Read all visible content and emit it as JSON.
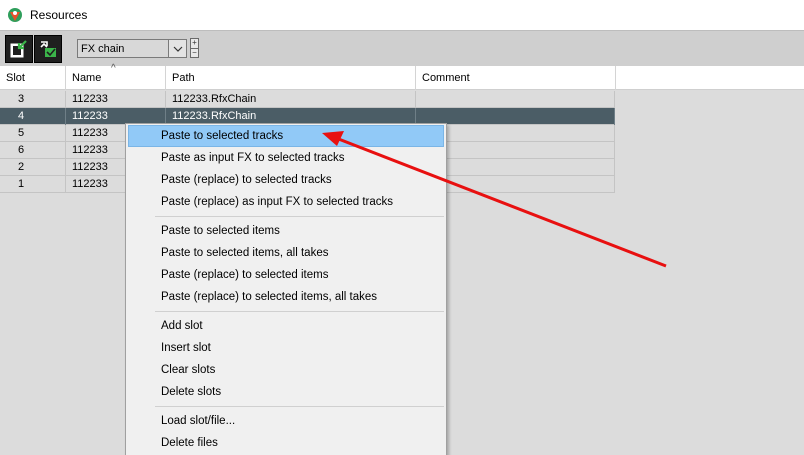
{
  "window": {
    "title": "Resources",
    "app_icon": "reaper-logo-icon"
  },
  "toolbar": {
    "buttons": [
      {
        "icon": "import-slot-icon"
      },
      {
        "icon": "auto-fill-slot-icon"
      }
    ],
    "combo_value": "FX chain",
    "combo_icon": "chevron-down-icon",
    "spin_plus": "+",
    "spin_minus": "−"
  },
  "table": {
    "columns": [
      "Slot",
      "Name",
      "Path",
      "Comment"
    ],
    "sort_indicator": "^",
    "rows": [
      {
        "slot": "3",
        "name": "112233",
        "path": "112233.RfxChain",
        "comment": ""
      },
      {
        "slot": "4",
        "name": "112233",
        "path": "112233.RfxChain",
        "comment": "",
        "selected": true
      },
      {
        "slot": "5",
        "name": "112233",
        "path": "",
        "comment": ""
      },
      {
        "slot": "6",
        "name": "112233",
        "path": "",
        "comment": ""
      },
      {
        "slot": "2",
        "name": "112233",
        "path": "",
        "comment": ""
      },
      {
        "slot": "1",
        "name": "112233",
        "path": "",
        "comment": ""
      }
    ]
  },
  "context_menu": {
    "groups": [
      [
        "Paste to selected tracks",
        "Paste as input FX to selected tracks",
        "Paste (replace) to selected tracks",
        "Paste (replace) as input FX to selected tracks"
      ],
      [
        "Paste to selected items",
        "Paste to selected items, all takes",
        "Paste (replace) to selected items",
        "Paste (replace) to selected items, all takes"
      ],
      [
        "Add slot",
        "Insert slot",
        "Clear slots",
        "Delete slots"
      ],
      [
        "Load slot/file...",
        "Delete files"
      ]
    ],
    "highlighted": "Paste to selected tracks"
  },
  "annotation": {
    "arrow_color": "#e81010"
  },
  "colors": {
    "selected_row": "#4b5d66",
    "menu_highlight": "#91c9f7",
    "button_green": "#3bb54a"
  }
}
